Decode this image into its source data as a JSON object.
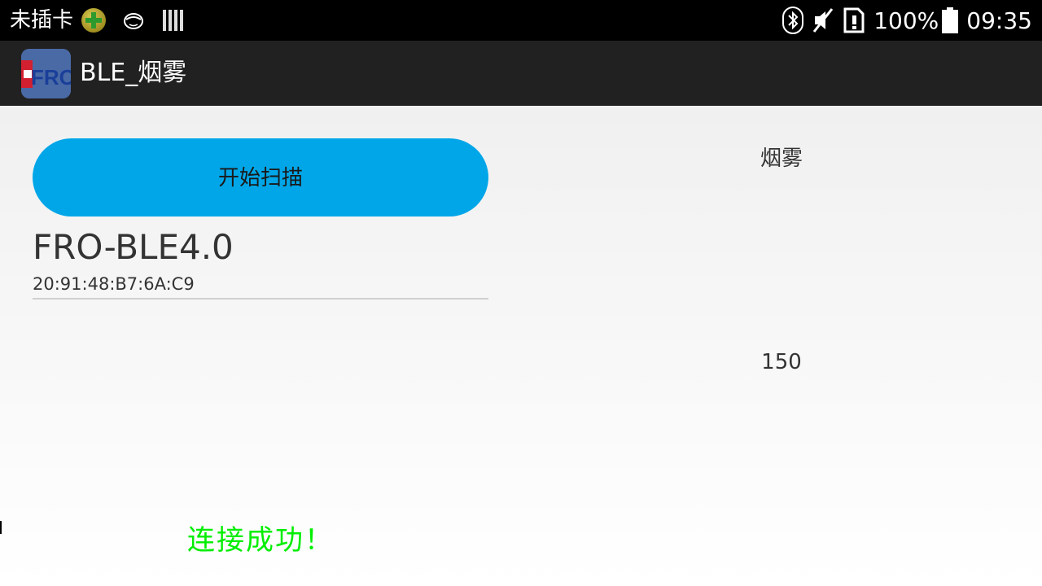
{
  "status_bar": {
    "sim_status": "未插卡",
    "battery_percent": "100%",
    "time": "09:35",
    "icons": [
      "plus-circle-icon",
      "face-icon",
      "bars-icon",
      "bluetooth-icon",
      "mute-icon",
      "sim-alert-icon",
      "battery-icon"
    ]
  },
  "action_bar": {
    "app_icon_label": "FRO",
    "title": "BLE_烟雾"
  },
  "main": {
    "scan_button_label": "开始扫描",
    "device": {
      "name": "FRO-BLE4.0",
      "address": "20:91:48:B7:6A:C9"
    },
    "sensor": {
      "label": "烟雾",
      "value": "150"
    },
    "connection_status": "连接成功！"
  },
  "colors": {
    "status_bar_bg": "#000000",
    "action_bar_bg": "#212121",
    "button_bg": "#00a6e8",
    "success_text": "#00ee00",
    "content_text": "#333333"
  }
}
